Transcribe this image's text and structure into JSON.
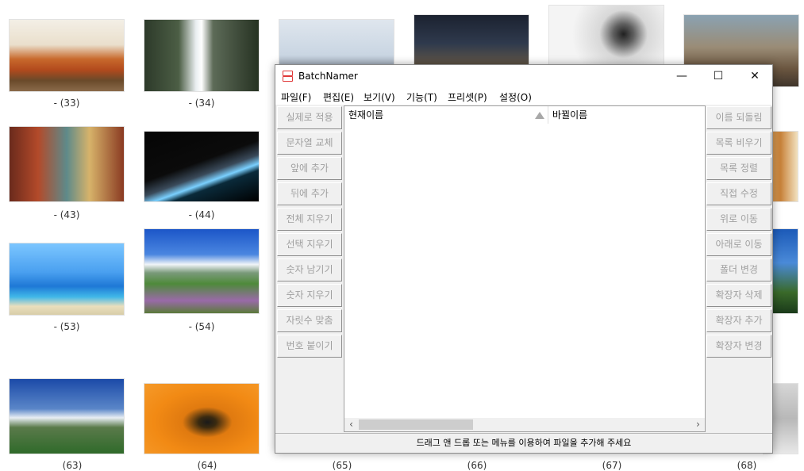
{
  "desktop": {
    "captions": {
      "c33": "- (33)",
      "c34": "- (34)",
      "c43": "- (43)",
      "c44": "- (44)",
      "c53": "- (53)",
      "c54": "- (54)",
      "c63": "(63)",
      "c64": "(64)",
      "c65": "(65)",
      "c66": "(66)",
      "c67": "(67)",
      "c68": "(68)"
    }
  },
  "window": {
    "title": "BatchNamer",
    "icon": "batchnamer-app-icon",
    "controls": {
      "minimize": "—",
      "maximize": "☐",
      "close": "✕"
    },
    "menu": [
      "파일(F)",
      "편집(E)",
      "보기(V)",
      "기능(T)",
      "프리셋(P)",
      "설정(O)"
    ],
    "left_buttons": [
      "실제로 적용",
      "문자열 교체",
      "앞에 추가",
      "뒤에 추가",
      "전체 지우기",
      "선택 지우기",
      "숫자 남기기",
      "숫자 지우기",
      "자릿수 맞춤",
      "번호 붙이기"
    ],
    "right_buttons": [
      "이름 되돌림",
      "목록 비우기",
      "목록 정렬",
      "직접 수정",
      "위로 이동",
      "아래로 이동",
      "폴더 변경",
      "확장자 삭제",
      "확장자 추가",
      "확장자 변경"
    ],
    "columns": {
      "current": "현재이름",
      "new": "바뀔이름"
    },
    "scroll": {
      "left": "‹",
      "right": "›"
    },
    "status": "드래그 앤 드롭 또는 메뉴를 이용하여 파일을 추가해 주세요"
  },
  "colors": {
    "icon_red": "#e03838",
    "disabled_text": "#a0a0a0"
  }
}
